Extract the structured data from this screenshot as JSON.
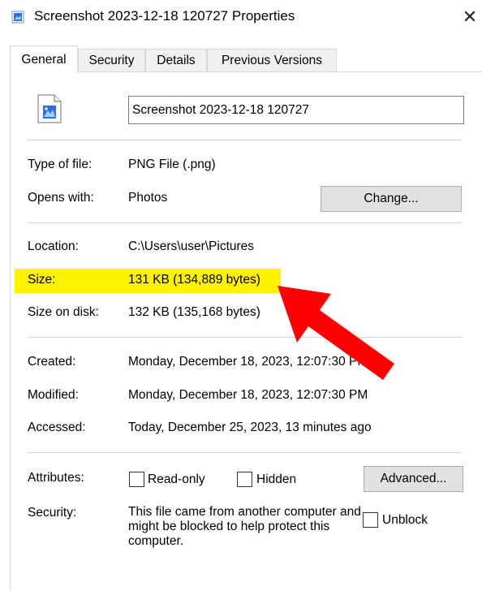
{
  "window": {
    "title": "Screenshot 2023-12-18 120727 Properties",
    "close_glyph": "✕"
  },
  "tabs": [
    {
      "label": "General",
      "active": true
    },
    {
      "label": "Security",
      "active": false
    },
    {
      "label": "Details",
      "active": false
    },
    {
      "label": "Previous Versions",
      "active": false
    }
  ],
  "file": {
    "name": "Screenshot 2023-12-18 120727",
    "icon": "png-image-file-icon"
  },
  "type_section": {
    "type_label": "Type of file:",
    "type_value": "PNG File (.png)",
    "opens_label": "Opens with:",
    "opens_value": "Photos",
    "change_button": "Change..."
  },
  "location_section": {
    "location_label": "Location:",
    "location_value": "C:\\Users\\user\\Pictures",
    "size_label": "Size:",
    "size_value": "131 KB (134,889 bytes)",
    "size_on_disk_label": "Size on disk:",
    "size_on_disk_value": "132 KB (135,168 bytes)",
    "highlight_color": "#fff200"
  },
  "dates_section": {
    "created_label": "Created:",
    "created_value": "Monday, December 18, 2023, 12:07:30 PM",
    "modified_label": "Modified:",
    "modified_value": "Monday, December 18, 2023, 12:07:30 PM",
    "accessed_label": "Accessed:",
    "accessed_value": "Today, December 25, 2023, 13 minutes ago"
  },
  "attributes_section": {
    "attributes_label": "Attributes:",
    "readonly_label": "Read-only",
    "readonly_checked": false,
    "hidden_label": "Hidden",
    "hidden_checked": false,
    "advanced_button": "Advanced...",
    "security_label": "Security:",
    "security_text": "This file came from another computer and might be blocked to help protect this computer.",
    "unblock_label": "Unblock",
    "unblock_checked": false
  },
  "annotation": {
    "arrow_color": "#ff0000",
    "arrow_icon": "red-arrow-pointer"
  }
}
